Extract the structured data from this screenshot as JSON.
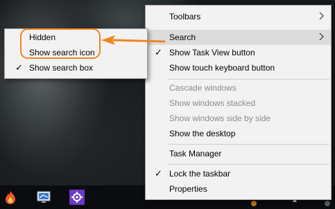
{
  "context_menu": {
    "items": [
      {
        "label": "Toolbars",
        "submenu": true,
        "checked": false,
        "disabled": false
      },
      {
        "label": "Search",
        "submenu": true,
        "checked": false,
        "disabled": false,
        "highlighted": true
      },
      {
        "label": "Show Task View button",
        "checked": true,
        "disabled": false
      },
      {
        "label": "Show touch keyboard button",
        "checked": false,
        "disabled": false
      },
      {
        "label": "Cascade windows",
        "checked": false,
        "disabled": true
      },
      {
        "label": "Show windows stacked",
        "checked": false,
        "disabled": true
      },
      {
        "label": "Show windows side by side",
        "checked": false,
        "disabled": true
      },
      {
        "label": "Show the desktop",
        "checked": false,
        "disabled": false
      },
      {
        "label": "Task Manager",
        "checked": false,
        "disabled": false
      },
      {
        "label": "Lock the taskbar",
        "checked": true,
        "disabled": false
      },
      {
        "label": "Properties",
        "checked": false,
        "disabled": false
      }
    ],
    "check_glyph": "✓"
  },
  "search_submenu": {
    "items": [
      {
        "label": "Hidden",
        "checked": false
      },
      {
        "label": "Show search icon",
        "checked": false
      },
      {
        "label": "Show search box",
        "checked": true
      }
    ],
    "check_glyph": "✓"
  },
  "colors": {
    "annotation": "#f0841c",
    "menu_bg": "#f2f2f2",
    "hover_bg": "#dcdcdc",
    "disabled_text": "#8a8a8a",
    "taskbar_bg": "#0b0c10"
  },
  "taskbar": {
    "icons": [
      "flame-app-icon",
      "monitor-app-icon",
      "gear-app-icon"
    ]
  }
}
